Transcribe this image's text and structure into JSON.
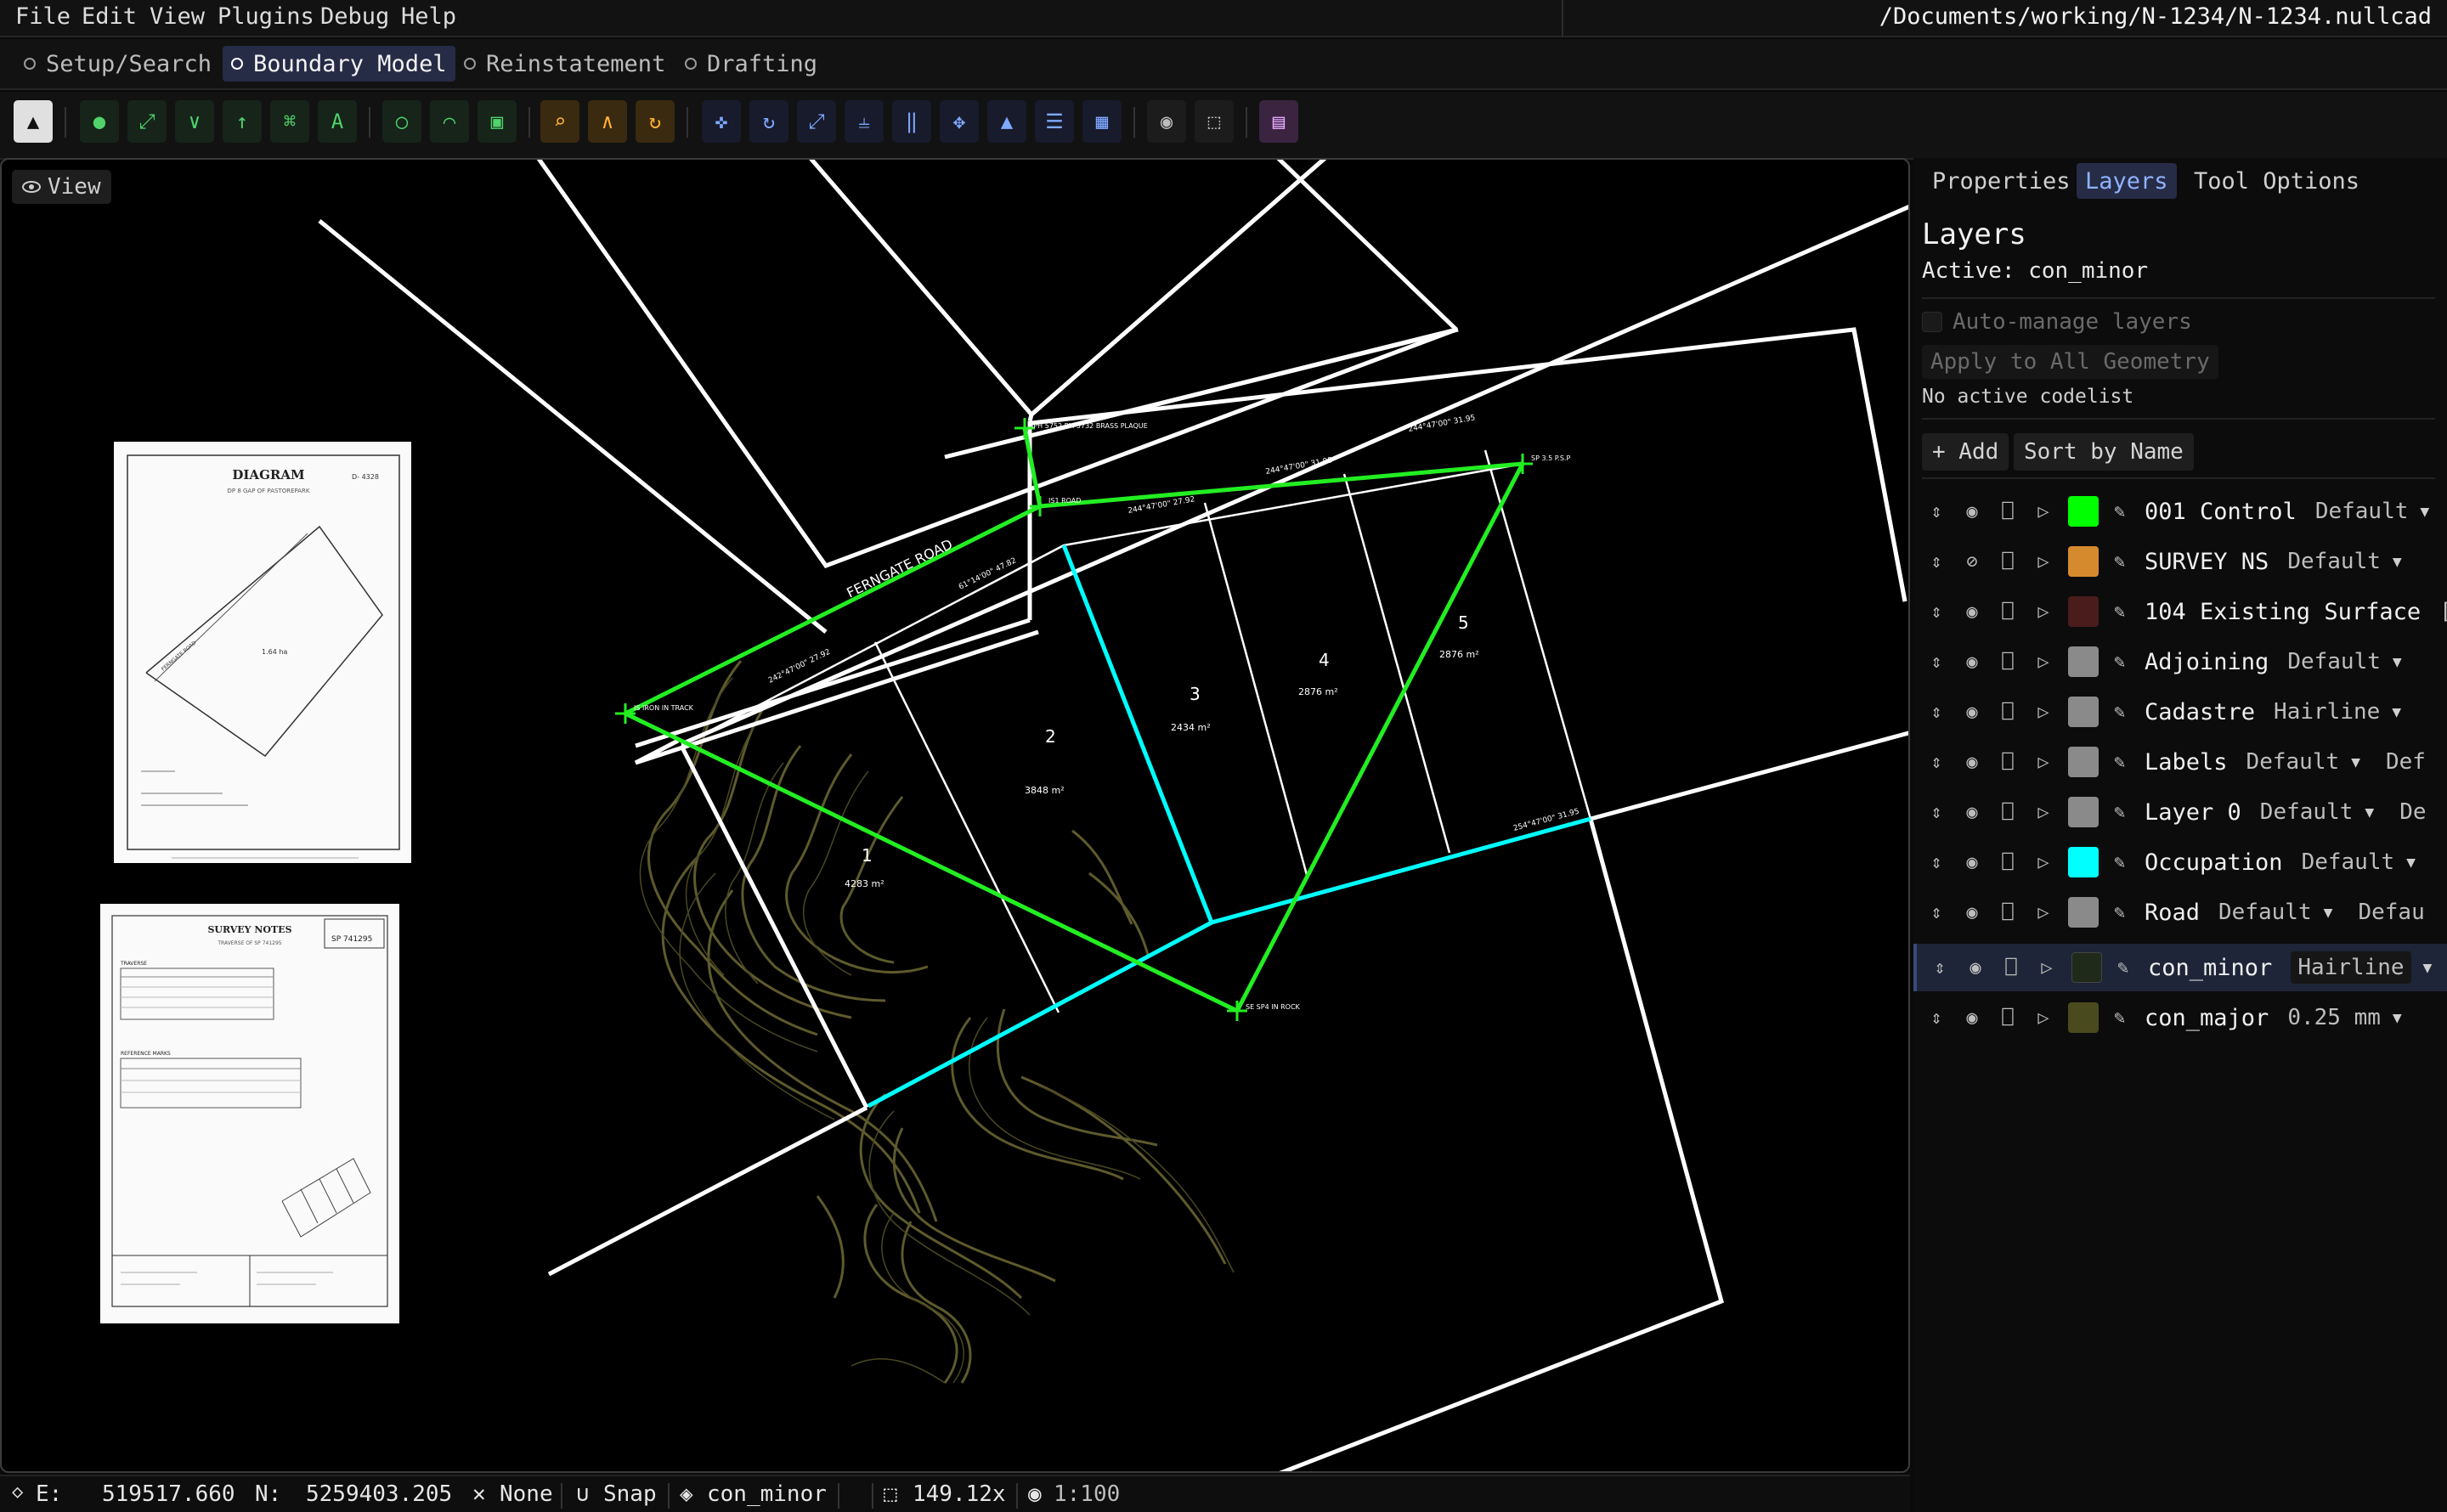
{
  "menu": [
    "File",
    "Edit",
    "View",
    "Plugins",
    "Debug",
    "Help"
  ],
  "file_path": "/Documents/working/N-1234/N-1234.nullcad",
  "workflow_tabs": [
    {
      "label": "Setup/Search",
      "active": false
    },
    {
      "label": "Boundary Model",
      "active": true
    },
    {
      "label": "Reinstatement",
      "active": false
    },
    {
      "label": "Drafting",
      "active": false
    }
  ],
  "toolbar_icons": [
    "select-icon",
    "point-icon",
    "line-icon",
    "polyline-icon",
    "arrow-icon",
    "bezier-icon",
    "text-icon",
    "circle-icon",
    "arc-icon",
    "rectangle-icon",
    "search-point-icon",
    "angle-icon",
    "traverse-icon",
    "move-icon",
    "rotate-icon",
    "scale-icon",
    "fillet-icon",
    "parallel-icon",
    "pan-icon",
    "terrain-icon",
    "document-icon",
    "grid-icon",
    "camera-icon",
    "zoom-extent-icon",
    "chat-icon"
  ],
  "viewport": {
    "view_label": "View",
    "road_label": "FERNGATE ROAD",
    "lot_numbers": [
      "1",
      "2",
      "3",
      "4",
      "5"
    ],
    "lot_areas": [
      "4283 m²",
      "3848 m²",
      "2434 m²",
      "2876 m²",
      "2876 m²"
    ],
    "control_labels": [
      "IPH 5752 PM 5732 BRASS PLAQUE",
      "IS1 ROAD",
      "SP 3.5 P.S.P",
      "IS IRON IN TRACK",
      "SE SP4 IN ROCK"
    ],
    "bearing_labels": [
      "61°14'00\" 47.82",
      "242°47'00\" 27.92",
      "244°47'00\" 27.92",
      "244°47'00\" 31.95",
      "244°47'00\" 31.95",
      "254°47'00\" 31.95"
    ],
    "doc1": {
      "title": "DIAGRAM",
      "subtitle": "DP 8 GAP OF PASTOREPARK",
      "ref": "D- 4328",
      "area": "1.64 ha",
      "road": "FERNGATE ROAD"
    },
    "doc2": {
      "title": "SURVEY NOTES",
      "subtitle": "TRAVERSE OF SP 741295",
      "plan": "SP 741295",
      "section1": "TRAVERSE",
      "section2": "REFERENCE MARKS"
    }
  },
  "panel": {
    "tabs": [
      {
        "label": "Properties",
        "active": false
      },
      {
        "label": "Layers",
        "active": true
      },
      {
        "label": "Tool Options",
        "active": false
      }
    ],
    "heading": "Layers",
    "active_text": "Active: con_minor",
    "auto_manage": "Auto-manage layers",
    "apply_all": "Apply to All Geometry",
    "codelist_status": "No active codelist",
    "add_label": "+ Add",
    "sort_label": "Sort by Name",
    "layers": [
      {
        "name": "001 Control",
        "style": "Default",
        "extra": "",
        "color": "#00ff00",
        "visible": true,
        "active": false
      },
      {
        "name": "SURVEY NS",
        "style": "Default",
        "extra": "",
        "color": "#d68a2e",
        "visible": false,
        "active": false
      },
      {
        "name": "104 Existing Surface",
        "style": "[",
        "extra": "",
        "color": "#4a1c1c",
        "visible": true,
        "active": false
      },
      {
        "name": "Adjoining",
        "style": "Default",
        "extra": "",
        "color": "#8a8a8a",
        "visible": true,
        "active": false
      },
      {
        "name": "Cadastre",
        "style": "Hairline",
        "extra": "",
        "color": "#8a8a8a",
        "visible": true,
        "active": false
      },
      {
        "name": "Labels",
        "style": "Default",
        "extra": "Def",
        "color": "#8a8a8a",
        "visible": true,
        "active": false
      },
      {
        "name": "Layer 0",
        "style": "Default",
        "extra": "De",
        "color": "#8a8a8a",
        "visible": true,
        "active": false
      },
      {
        "name": "Occupation",
        "style": "Default",
        "extra": "",
        "color": "#00ffff",
        "visible": true,
        "active": false
      },
      {
        "name": "Road",
        "style": "Default",
        "extra": "Defau",
        "color": "#8a8a8a",
        "visible": true,
        "active": false
      },
      {
        "name": "con_minor",
        "style": "Hairline",
        "extra": "",
        "color": "#1f2a1a",
        "visible": true,
        "active": true
      },
      {
        "name": "con_major",
        "style": "0.25 mm",
        "extra": "",
        "color": "#4a4a1f",
        "visible": true,
        "active": false
      }
    ]
  },
  "status": {
    "e_label": "E:",
    "e_value": "519517.660",
    "n_label": "N:",
    "n_value": "5259403.205",
    "snap_mode": "None",
    "snap_label": "Snap",
    "layer": "con_minor",
    "zoom": "149.12x",
    "scale": "1:100"
  },
  "colors": {
    "accent": "#262b46",
    "control": "#00ff00",
    "occupation": "#00ffff",
    "contour": "#5e5a2c"
  }
}
